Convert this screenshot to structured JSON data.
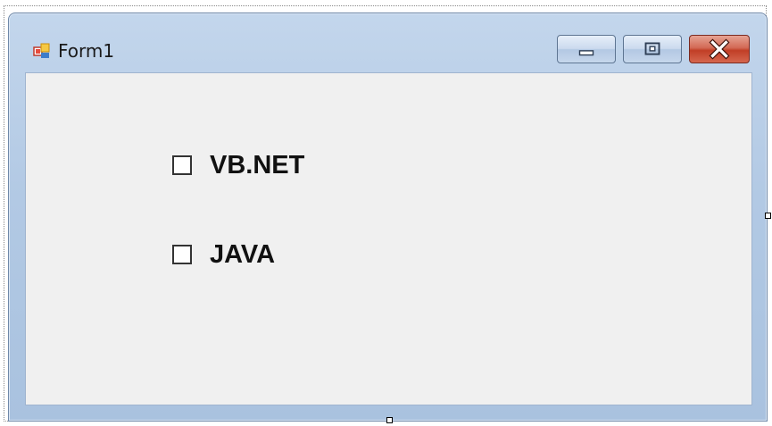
{
  "window": {
    "title": "Form1",
    "icon": "winforms-form-icon",
    "controls": {
      "minimize": "minimize-icon",
      "maximize": "maximize-icon",
      "close": "close-icon"
    }
  },
  "form": {
    "checkboxes": [
      {
        "label": "VB.NET",
        "checked": false
      },
      {
        "label": "JAVA",
        "checked": false
      }
    ]
  },
  "colors": {
    "titlebar": "#b2c9e4",
    "client_background": "#f0f0f0",
    "close_button": "#c13e26"
  }
}
